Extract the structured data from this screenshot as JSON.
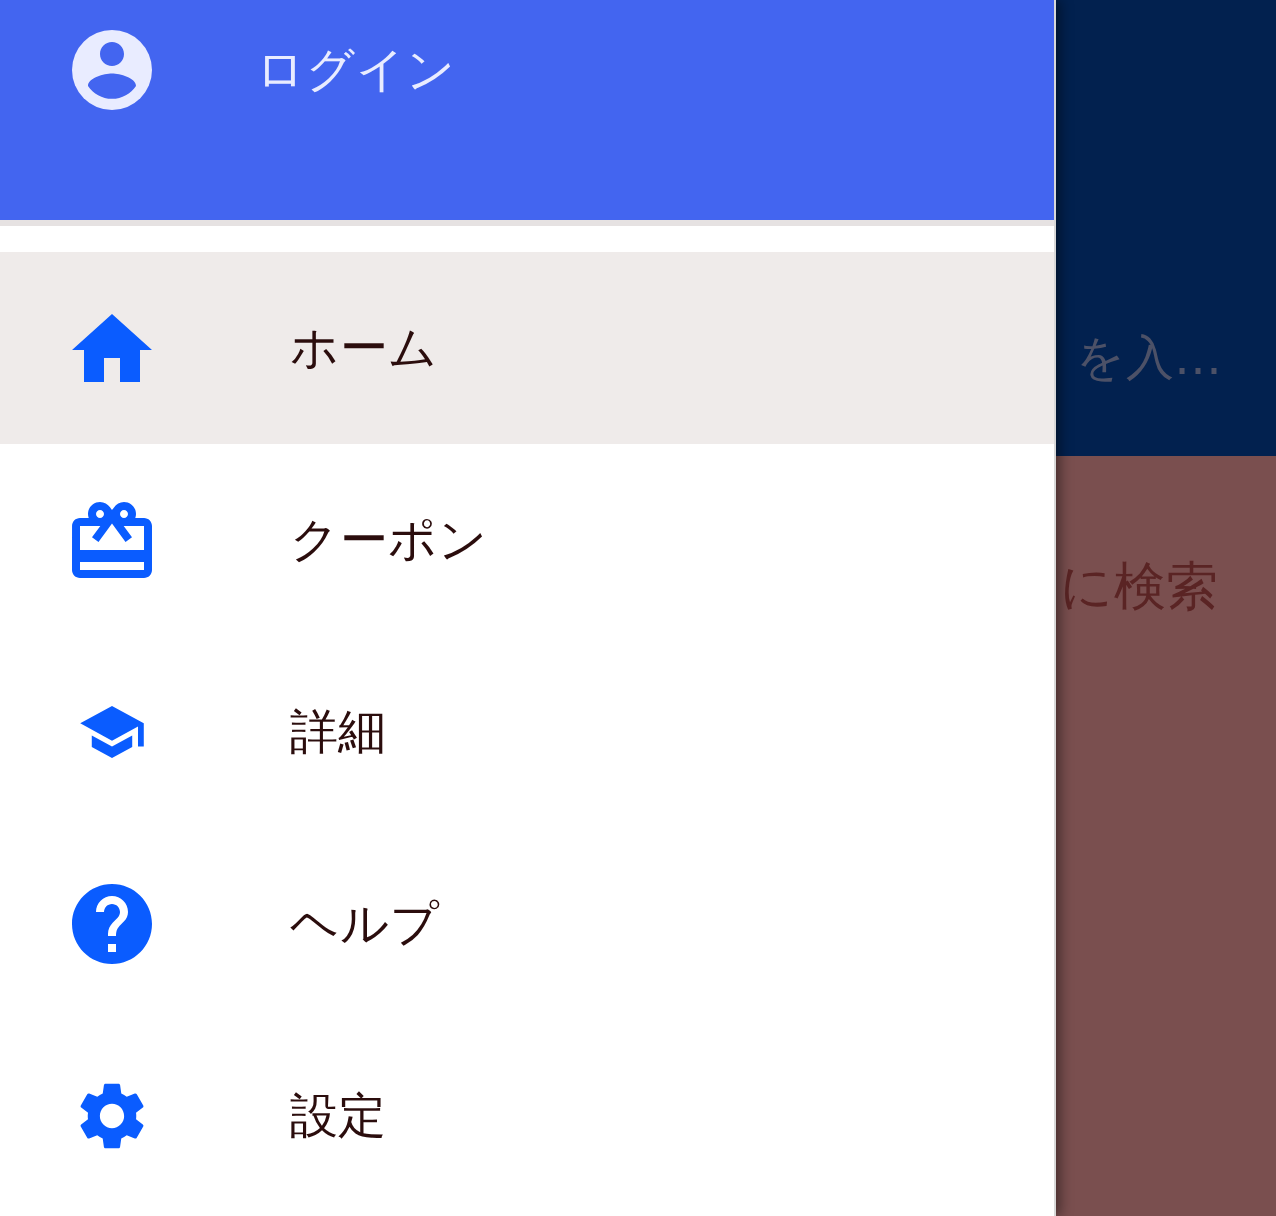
{
  "header": {
    "title": "ログイン"
  },
  "menu": [
    {
      "kind": "home",
      "label": "ホーム",
      "selected": true
    },
    {
      "kind": "coupon",
      "label": "クーポン",
      "selected": false
    },
    {
      "kind": "details",
      "label": "詳細",
      "selected": false
    },
    {
      "kind": "help",
      "label": "ヘルプ",
      "selected": false
    },
    {
      "kind": "settings",
      "label": "設定",
      "selected": false
    }
  ],
  "background": {
    "search_placeholder": "を入…",
    "banner_text": "に検索"
  }
}
